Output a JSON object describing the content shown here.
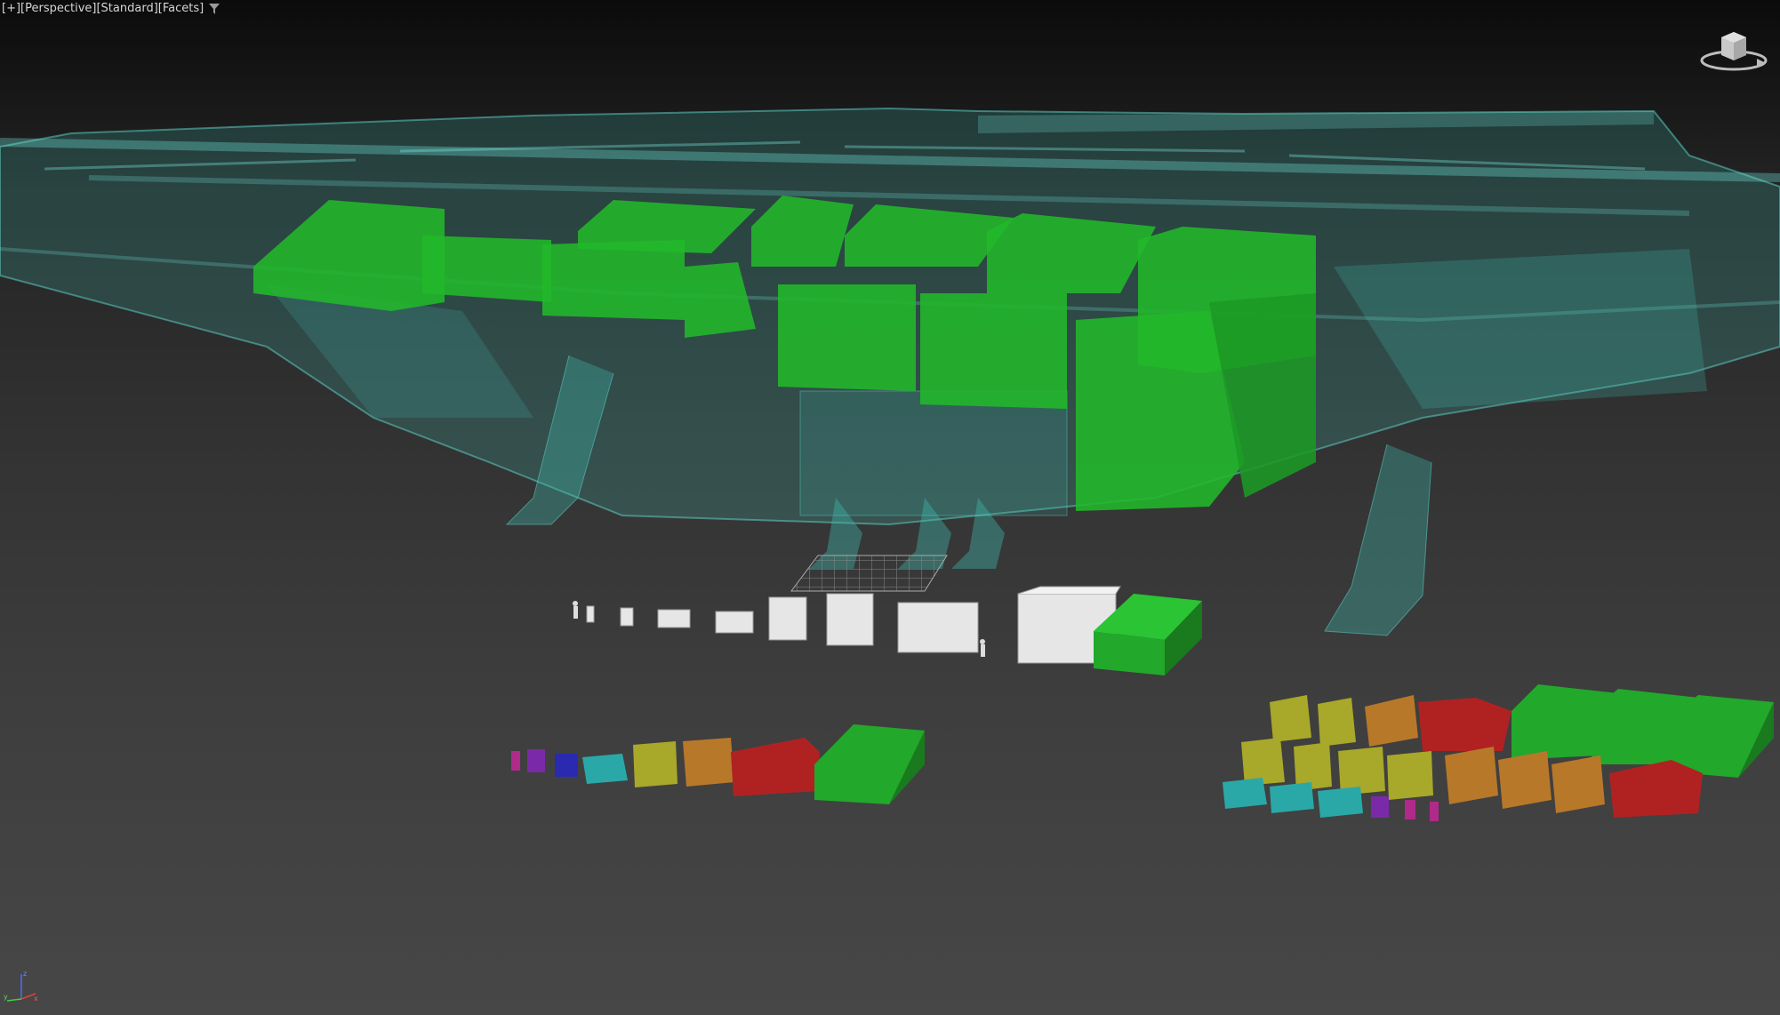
{
  "viewport": {
    "labels": [
      "[+]",
      "[Perspective]",
      "[Standard]",
      "[Facets]"
    ],
    "filter_icon": "funnel-icon",
    "viewcube_icon": "viewcube-icon",
    "axis_icon": "axis-tripod-icon",
    "axis_labels": {
      "x": "x",
      "y": "y",
      "z": "z"
    }
  },
  "colors": {
    "background_top": "#0b0b0b",
    "background_bottom": "#474747",
    "ship_wireframe": "#3fb8ad",
    "cargo_green": "#22a82a",
    "cargo_red": "#b02222",
    "cargo_orange": "#b8782a",
    "cargo_yellow": "#a8a82a",
    "cargo_teal": "#2aa8a8",
    "cargo_blue": "#2a2ab0",
    "cargo_purple": "#7a2aa8",
    "cargo_magenta": "#b02a8a",
    "crate_white": "#e6e6e6"
  }
}
